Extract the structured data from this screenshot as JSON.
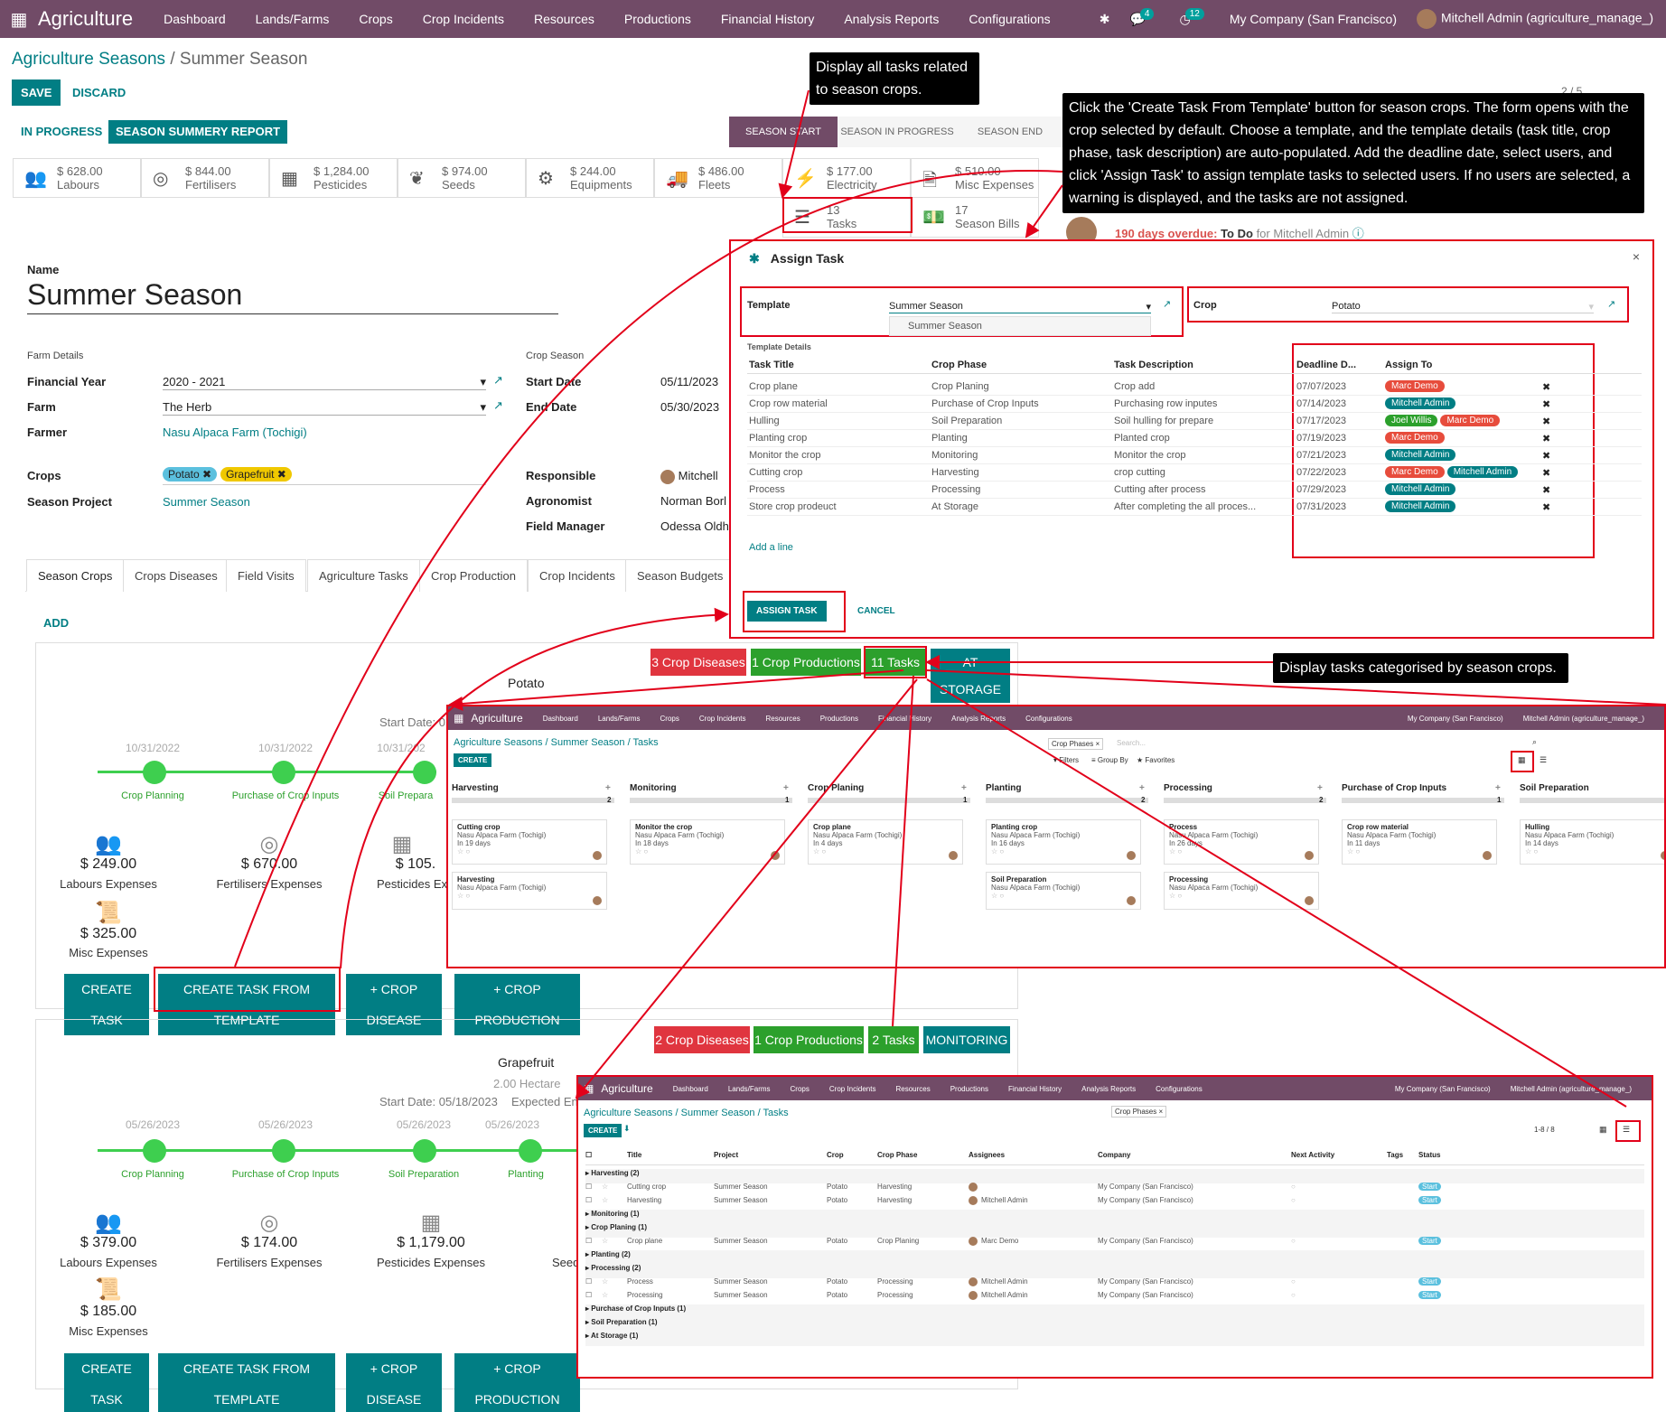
{
  "topbar": {
    "brand": "Agriculture",
    "menu": [
      "Dashboard",
      "Lands/Farms",
      "Crops",
      "Crop Incidents",
      "Resources",
      "Productions",
      "Financial History",
      "Analysis Reports",
      "Configurations"
    ],
    "msg_count": "4",
    "activity_count": "12",
    "company": "My Company (San Francisco)",
    "user": "Mitchell Admin (agriculture_manage_)"
  },
  "breadcrumb": {
    "parent": "Agriculture Seasons",
    "current": "Summer Season"
  },
  "actions": {
    "save": "SAVE",
    "discard": "DISCARD",
    "pager": "2 / 5"
  },
  "status_buttons": {
    "in_progress": "IN PROGRESS",
    "report": "SEASON SUMMERY REPORT"
  },
  "stages": [
    "SEASON START",
    "SEASON IN PROGRESS",
    "SEASON END"
  ],
  "stats": [
    {
      "value": "$ 628.00",
      "label": "Labours",
      "icon": "users-icon"
    },
    {
      "value": "$ 844.00",
      "label": "Fertilisers",
      "icon": "lifering-icon"
    },
    {
      "value": "$ 1,284.00",
      "label": "Pesticides",
      "icon": "cubes-icon"
    },
    {
      "value": "$ 974.00",
      "label": "Seeds",
      "icon": "leaf-icon"
    },
    {
      "value": "$ 244.00",
      "label": "Equipments",
      "icon": "cogs-icon"
    },
    {
      "value": "$ 486.00",
      "label": "Fleets",
      "icon": "truck-icon"
    },
    {
      "value": "$ 177.00",
      "label": "Electricity",
      "icon": "bolt-icon"
    },
    {
      "value": "$ 510.00",
      "label": "Misc Expenses",
      "icon": "file-icon"
    }
  ],
  "tasks_stat": {
    "value": "13",
    "label": "Tasks"
  },
  "bills_stat": {
    "value": "17",
    "label": "Season Bills"
  },
  "chatter": {
    "overdue": "190 days overdue:",
    "todo": "To Do",
    "for": "for Mitchell Admin"
  },
  "form": {
    "name_label": "Name",
    "name": "Summer Season",
    "farm_details": "Farm Details",
    "crop_season": "Crop Season",
    "financial_year_label": "Financial Year",
    "financial_year": "2020 - 2021",
    "farm_label": "Farm",
    "farm": "The Herb",
    "farmer_label": "Farmer",
    "farmer": "Nasu Alpaca Farm (Tochigi)",
    "crops_label": "Crops",
    "crops": [
      "Potato",
      "Grapefruit"
    ],
    "season_project_label": "Season Project",
    "season_project": "Summer Season",
    "start_label": "Start Date",
    "start": "05/11/2023",
    "end_label": "End Date",
    "end": "05/30/2023",
    "responsible_label": "Responsible",
    "responsible": "Mitchell",
    "agronomist_label": "Agronomist",
    "agronomist": "Norman Borl",
    "field_manager_label": "Field Manager",
    "field_manager": "Odessa Oldh"
  },
  "tabs": [
    "Season Crops",
    "Crops Diseases",
    "Field Visits",
    "Agriculture Tasks",
    "Crop Production",
    "Crop Incidents",
    "Season Budgets"
  ],
  "add": "ADD",
  "callouts": {
    "all_tasks": "Display all tasks related to season crops.",
    "template": "Click the 'Create Task From Template' button for season crops. The form opens with the crop selected by default. Choose a template, and the template details (task title, crop phase, task description) are auto-populated. Add the deadline date, select users, and click 'Assign Task' to assign template tasks to selected users. If no users are selected, a warning is displayed, and the tasks are not assigned.",
    "categorised": "Display tasks categorised by season crops."
  },
  "modal": {
    "title": "Assign Task",
    "template_label": "Template",
    "template": "Summer Season",
    "dropdown_option": "Summer Season",
    "crop_label": "Crop",
    "crop": "Potato",
    "details": "Template Details",
    "headers": [
      "Task Title",
      "Crop Phase",
      "Task Description",
      "Deadline D...",
      "Assign To"
    ],
    "rows": [
      {
        "title": "Crop plane",
        "phase": "Crop Planing",
        "desc": "Crop add",
        "date": "07/07/2023",
        "assign": [
          [
            "Marc Demo",
            "#e74c3c"
          ]
        ]
      },
      {
        "title": "Crop row material",
        "phase": "Purchase of Crop Inputs",
        "desc": "Purchasing row inputes",
        "date": "07/14/2023",
        "assign": [
          [
            "Mitchell Admin",
            "#017E84"
          ]
        ]
      },
      {
        "title": "Hulling",
        "phase": "Soil Preparation",
        "desc": "Soil hulling for prepare",
        "date": "07/17/2023",
        "assign": [
          [
            "Joel Willis",
            "#2ca02c"
          ],
          [
            "Marc Demo",
            "#e74c3c"
          ]
        ]
      },
      {
        "title": "Planting crop",
        "phase": "Planting",
        "desc": "Planted crop",
        "date": "07/19/2023",
        "assign": [
          [
            "Marc Demo",
            "#e74c3c"
          ]
        ]
      },
      {
        "title": "Monitor the crop",
        "phase": "Monitoring",
        "desc": "Monitor the crop",
        "date": "07/21/2023",
        "assign": [
          [
            "Mitchell Admin",
            "#017E84"
          ]
        ]
      },
      {
        "title": "Cutting crop",
        "phase": "Harvesting",
        "desc": "crop cutting",
        "date": "07/22/2023",
        "assign": [
          [
            "Marc Demo",
            "#e74c3c"
          ],
          [
            "Mitchell Admin",
            "#017E84"
          ]
        ]
      },
      {
        "title": "Process",
        "phase": "Processing",
        "desc": "Cutting after process",
        "date": "07/29/2023",
        "assign": [
          [
            "Mitchell Admin",
            "#017E84"
          ]
        ]
      },
      {
        "title": "Store crop prodeuct",
        "phase": "At Storage",
        "desc": "After completing the all proces...",
        "date": "07/31/2023",
        "assign": [
          [
            "Mitchell Admin",
            "#017E84"
          ]
        ]
      }
    ],
    "add_line": "Add a line",
    "assign": "ASSIGN TASK",
    "cancel": "CANCEL"
  },
  "crop1": {
    "name": "Potato",
    "start": "Start Date: 0",
    "chips": [
      "3 Crop Diseases",
      "1 Crop Productions",
      "11 Tasks",
      "AT STORAGE"
    ],
    "stages": [
      [
        "10/31/2022",
        "Crop Planning"
      ],
      [
        "10/31/2022",
        "Purchase of Crop Inputs"
      ],
      [
        "10/31/202",
        "Soil Prepara"
      ]
    ],
    "expenses": [
      [
        "$ 249.00",
        "Labours Expenses"
      ],
      [
        "$ 670.00",
        "Fertilisers Expenses"
      ],
      [
        "$ 105.",
        "Pesticides Ex"
      ]
    ],
    "misc": [
      "$ 325.00",
      "Misc Expenses"
    ]
  },
  "crop2": {
    "name": "Grapefruit",
    "area": "2.00  Hectare",
    "start": "Start Date: 05/18/2023",
    "expected": "Expected End",
    "chips": [
      "2 Crop Diseases",
      "1 Crop Productions",
      "2 Tasks",
      "MONITORING"
    ],
    "stages": [
      [
        "05/26/2023",
        "Crop Planning"
      ],
      [
        "05/26/2023",
        "Purchase of Crop Inputs"
      ],
      [
        "05/26/2023",
        "Soil Preparation"
      ],
      [
        "05/26/2023",
        "Planting"
      ]
    ],
    "expenses": [
      [
        "$ 379.00",
        "Labours Expenses"
      ],
      [
        "$ 174.00",
        "Fertilisers Expenses"
      ],
      [
        "$ 1,179.00",
        "Pesticides Expenses"
      ]
    ],
    "misc": [
      "$ 185.00",
      "Misc Expenses"
    ],
    "seed": "Seed"
  },
  "crop_buttons": [
    "CREATE TASK",
    "CREATE TASK FROM TEMPLATE",
    "+ CROP DISEASE",
    "+ CROP PRODUCTION"
  ],
  "kanban": {
    "breadcrumb": "Agriculture Seasons / Summer Season / Tasks",
    "create": "CREATE",
    "facet": "Crop Phases",
    "search": "Search...",
    "filters": "Filters",
    "group": "Group By",
    "fav": "Favorites",
    "columns": [
      {
        "name": "Harvesting",
        "count": "2",
        "cards": [
          [
            "Cutting crop",
            "Nasu Alpaca Farm (Tochigi)",
            "In 19 days"
          ],
          [
            "Harvesting",
            "Nasu Alpaca Farm (Tochigi)",
            ""
          ]
        ]
      },
      {
        "name": "Monitoring",
        "count": "1",
        "cards": [
          [
            "Monitor the crop",
            "Nasu Alpaca Farm (Tochigi)",
            "In 18 days"
          ]
        ]
      },
      {
        "name": "Crop Planing",
        "count": "1",
        "cards": [
          [
            "Crop plane",
            "Nasu Alpaca Farm (Tochigi)",
            "In 4 days"
          ]
        ]
      },
      {
        "name": "Planting",
        "count": "2",
        "cards": [
          [
            "Planting crop",
            "Nasu Alpaca Farm (Tochigi)",
            "In 16 days"
          ],
          [
            "Soil Preparation",
            "Nasu Alpaca Farm (Tochigi)",
            ""
          ]
        ]
      },
      {
        "name": "Processing",
        "count": "2",
        "cards": [
          [
            "Process",
            "Nasu Alpaca Farm (Tochigi)",
            "In 26 days"
          ],
          [
            "Processing",
            "Nasu Alpaca Farm (Tochigi)",
            ""
          ]
        ]
      },
      {
        "name": "Purchase of Crop Inputs",
        "count": "1",
        "cards": [
          [
            "Crop row material",
            "Nasu Alpaca Farm (Tochigi)",
            "In 11 days"
          ]
        ]
      },
      {
        "name": "Soil Preparation",
        "count": "1",
        "cards": [
          [
            "Hulling",
            "Nasu Alpaca Farm (Tochigi)",
            "In 14 days"
          ]
        ]
      }
    ]
  },
  "listview": {
    "breadcrumb": "Agriculture Seasons / Summer Season / Tasks",
    "create": "CREATE",
    "pager": "1-8 / 8",
    "headers": [
      "Title",
      "Project",
      "Crop",
      "Crop Phase",
      "Assignees",
      "Company",
      "Next Activity",
      "Tags",
      "Status"
    ],
    "rows": [
      {
        "g": "Harvesting (2)"
      },
      {
        "t": "Cutting crop",
        "p": "Summer Season",
        "c": "Potato",
        "ph": "Harvesting",
        "a": "",
        "co": "My Company (San Francisco)",
        "s": "Start"
      },
      {
        "t": "Harvesting",
        "p": "Summer Season",
        "c": "Potato",
        "ph": "Harvesting",
        "a": "Mitchell Admin",
        "co": "My Company (San Francisco)",
        "s": "Start"
      },
      {
        "g": "Monitoring (1)"
      },
      {
        "g": "Crop Planing (1)"
      },
      {
        "t": "Crop plane",
        "p": "Summer Season",
        "c": "Potato",
        "ph": "Crop Planing",
        "a": "Marc Demo",
        "co": "My Company (San Francisco)",
        "s": "Start"
      },
      {
        "g": "Planting (2)"
      },
      {
        "g": "Processing (2)"
      },
      {
        "t": "Process",
        "p": "Summer Season",
        "c": "Potato",
        "ph": "Processing",
        "a": "Mitchell Admin",
        "co": "My Company (San Francisco)",
        "s": "Start"
      },
      {
        "t": "Processing",
        "p": "Summer Season",
        "c": "Potato",
        "ph": "Processing",
        "a": "Mitchell Admin",
        "co": "My Company (San Francisco)",
        "s": "Start"
      },
      {
        "g": "Purchase of Crop Inputs (1)"
      },
      {
        "g": "Soil Preparation (1)"
      },
      {
        "g": "At Storage (1)"
      }
    ]
  }
}
